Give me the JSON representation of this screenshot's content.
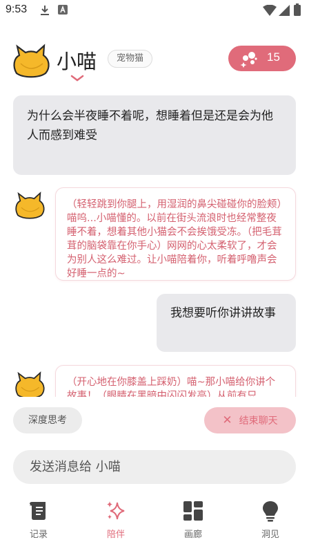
{
  "status_bar": {
    "time": "9:53"
  },
  "header": {
    "pet_name": "小喵",
    "pet_tag": "宠物猫",
    "points": "15"
  },
  "messages": [
    {
      "role": "user",
      "text": "为什么会半夜睡不着呢，想睡着但是还是会为他人而感到难受"
    },
    {
      "role": "ai",
      "text": "（轻轻跳到你腿上，用湿润的鼻尖碰碰你的脸颊）喵呜...小喵懂的。以前在街头流浪时也经常整夜睡不着，想着其他小猫会不会挨饿受冻。（把毛茸茸的脑袋靠在你手心）网网的心太柔软了，才会为别人这么难过。让小喵陪着你，听着呼噜声会好睡一点的~"
    },
    {
      "role": "user",
      "text": "我想要听你讲讲故事"
    },
    {
      "role": "ai",
      "text": "（开心地在你膝盖上踩奶）喵~那小喵给你讲个故事！（眼睛在黑暗中闪闪发亮）从前有只"
    }
  ],
  "actions": {
    "deep_think": "深度思考",
    "end_chat": "结束聊天"
  },
  "composer": {
    "placeholder": "发送消息给 小喵"
  },
  "tabs": [
    {
      "label": "记录",
      "icon": "scroll-icon"
    },
    {
      "label": "陪伴",
      "icon": "sparkle-icon"
    },
    {
      "label": "画廊",
      "icon": "gallery-grid-icon"
    },
    {
      "label": "洞见",
      "icon": "lightbulb-icon"
    }
  ],
  "colors": {
    "accent": "#e06b7a",
    "user_bubble": "#e9e9ec",
    "ai_text": "#d4606f",
    "cat_yellow": "#f5b82a"
  }
}
